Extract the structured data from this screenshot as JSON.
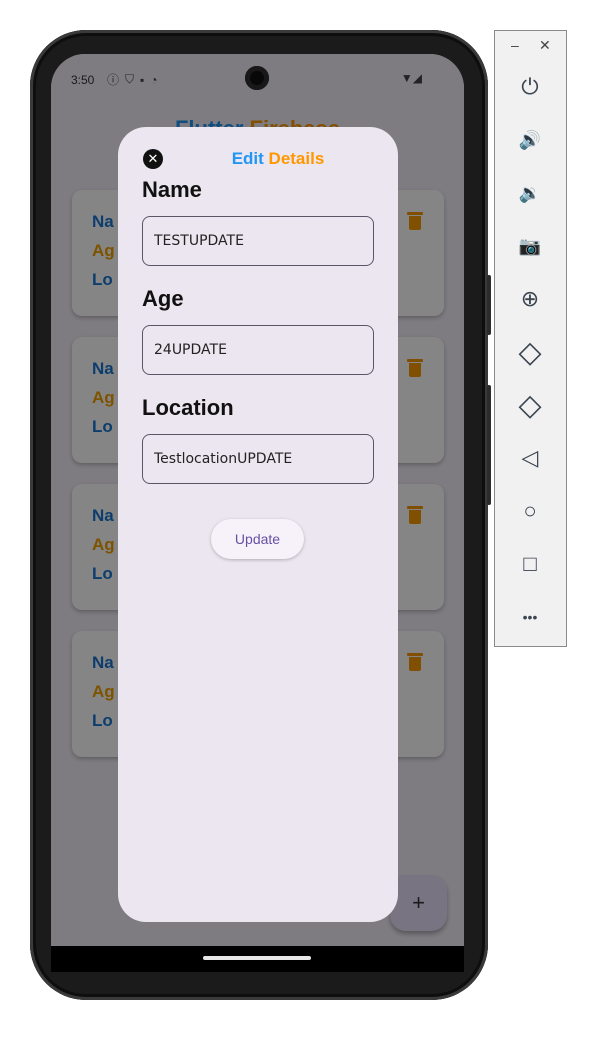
{
  "status_bar": {
    "time": "3:50",
    "icons": [
      "info-icon",
      "shield-icon",
      "sd-card-icon",
      "sync-icon"
    ],
    "right_icons": [
      "wifi-icon",
      "signal-icon"
    ]
  },
  "app": {
    "title_part1": "Flutter",
    "title_part2": " Firebase",
    "cards": [
      {
        "name_label": "Na",
        "age_label": "Ag",
        "location_label": "Lo"
      },
      {
        "name_label": "Na",
        "age_label": "Ag",
        "location_label": "Lo"
      },
      {
        "name_label": "Na",
        "age_label": "Ag",
        "location_label": "Lo"
      },
      {
        "name_label": "Na",
        "age_label": "Ag",
        "location_label": "Lo"
      }
    ],
    "fab_label": "+"
  },
  "dialog": {
    "title_part1": "Edit",
    "title_part2": " Details",
    "close_glyph": "✕",
    "name_label": "Name",
    "name_value": "TESTUPDATE",
    "age_label": "Age",
    "age_value": "24UPDATE",
    "location_label": "Location",
    "location_value": "TestlocationUPDATE",
    "update_button": "Update"
  },
  "emulator_panel": {
    "minimize": "–",
    "close": "✕",
    "buttons": [
      {
        "name": "power-icon",
        "glyph": "⏻"
      },
      {
        "name": "volume-up-icon",
        "glyph": "🔊"
      },
      {
        "name": "volume-down-icon",
        "glyph": "🔉"
      },
      {
        "name": "camera-icon",
        "glyph": "📷"
      },
      {
        "name": "zoom-icon",
        "glyph": "⊕"
      },
      {
        "name": "rotate-left-icon",
        "glyph": "◇"
      },
      {
        "name": "rotate-right-icon",
        "glyph": "◇"
      },
      {
        "name": "back-icon",
        "glyph": "◁"
      },
      {
        "name": "home-icon",
        "glyph": "○"
      },
      {
        "name": "overview-icon",
        "glyph": "□"
      },
      {
        "name": "more-icon",
        "glyph": "•••"
      }
    ]
  },
  "colors": {
    "accent_blue": "#2196f3",
    "accent_orange": "#ff9800",
    "dialog_bg": "#ece6f0",
    "button_text": "#6750a4"
  }
}
